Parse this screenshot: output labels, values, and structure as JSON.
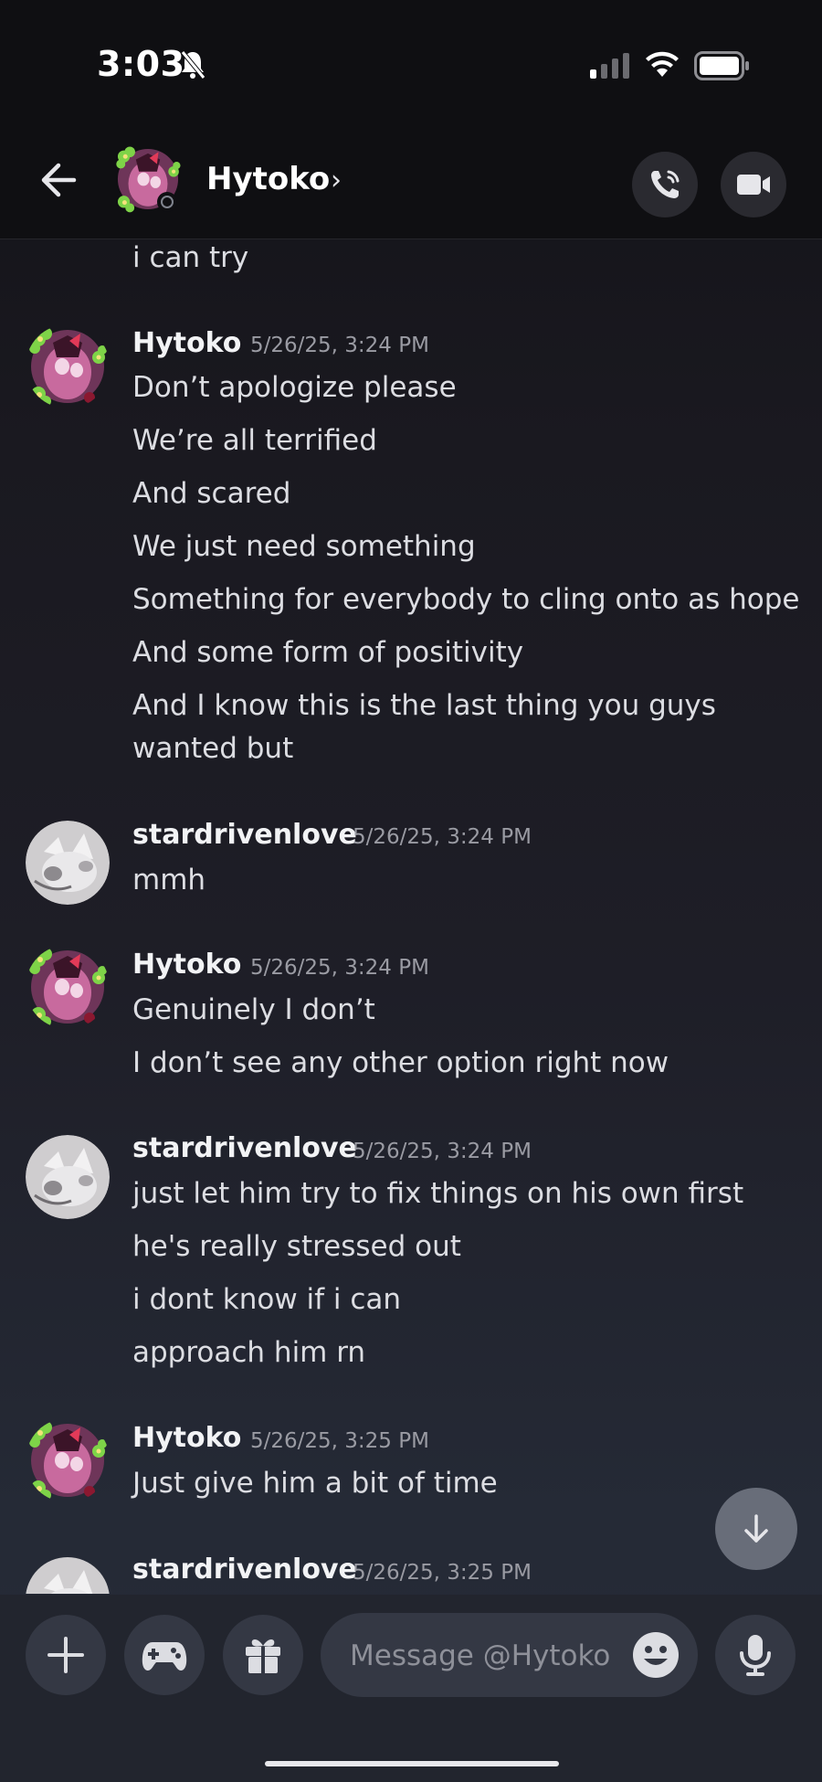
{
  "status_bar": {
    "time": "3:03",
    "icons": [
      "bell-slash-icon",
      "cellular-signal-icon",
      "wifi-icon",
      "battery-icon"
    ]
  },
  "header": {
    "name": "Hytoko",
    "chevron": "›",
    "back_icon": "arrow-left-icon",
    "call_icon": "phone-call-icon",
    "video_icon": "video-camera-icon"
  },
  "messages": {
    "prev_tail": "i can try",
    "groups": [
      {
        "author": "Hytoko",
        "timestamp": "5/26/25, 3:24 PM",
        "lines": [
          "Don’t apologize please",
          "We’re all terrified",
          "And scared",
          "We just need something",
          "Something for everybody to cling onto as hope",
          "And some form of positivity",
          "And I know this is the last thing you guys",
          "wanted but"
        ]
      },
      {
        "author": "stardrivenlove",
        "timestamp": "5/26/25, 3:24 PM",
        "lines": [
          "mmh"
        ]
      },
      {
        "author": "Hytoko",
        "timestamp": "5/26/25, 3:24 PM",
        "lines": [
          "Genuinely I don’t",
          "I don’t see any other option right now"
        ]
      },
      {
        "author": "stardrivenlove",
        "timestamp": "5/26/25, 3:24 PM",
        "lines": [
          "just let him try to fix things on his own first",
          "he's really stressed out",
          "i dont know if i can",
          "approach him rn"
        ]
      },
      {
        "author": "Hytoko",
        "timestamp": "5/26/25, 3:25 PM",
        "lines": [
          "Just give him a bit of time"
        ]
      },
      {
        "author": "stardrivenlove",
        "timestamp": "5/26/25, 3:25 PM",
        "lines": []
      }
    ]
  },
  "composer": {
    "placeholder": "Message @Hytoko",
    "add_icon": "plus-icon",
    "games_icon": "gamepad-icon",
    "gift_icon": "gift-icon",
    "emoji_icon": "emoji-icon",
    "mic_icon": "microphone-icon",
    "jump_icon": "arrow-down-icon"
  },
  "colors": {
    "background_top": "#121217",
    "background_bottom": "#262b38",
    "text": "#dcdde2",
    "timestamp": "#9a9ba3",
    "button": "#343844"
  }
}
